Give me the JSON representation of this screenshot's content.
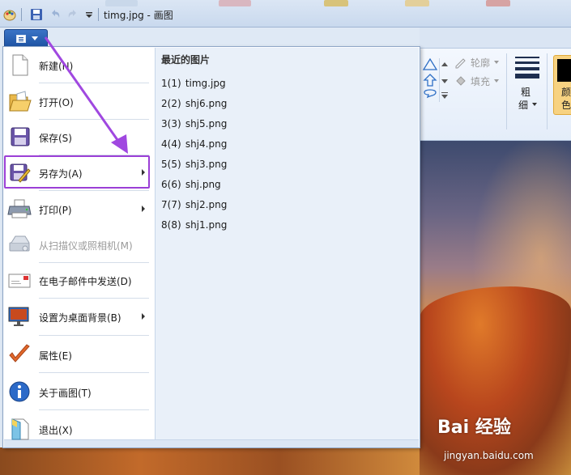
{
  "window": {
    "title": "timg.jpg - 画图"
  },
  "ribbon": {
    "outline_label": "轮廓",
    "fill_label": "填充",
    "size_label_1": "粗",
    "size_label_2": "细",
    "color_label_1": "颜",
    "color_label_2": "色"
  },
  "app_menu": {
    "items": [
      {
        "label": "新建(N)",
        "icon": "new-file-icon",
        "enabled": true,
        "submenu": false
      },
      {
        "label": "打开(O)",
        "icon": "open-folder-icon",
        "enabled": true,
        "submenu": false
      },
      {
        "label": "保存(S)",
        "icon": "save-disk-icon",
        "enabled": true,
        "submenu": false
      },
      {
        "label": "另存为(A)",
        "icon": "save-as-icon",
        "enabled": true,
        "submenu": true
      },
      {
        "label": "打印(P)",
        "icon": "printer-icon",
        "enabled": true,
        "submenu": true
      },
      {
        "label": "从扫描仪或照相机(M)",
        "icon": "scanner-icon",
        "enabled": false,
        "submenu": false
      },
      {
        "label": "在电子邮件中发送(D)",
        "icon": "email-icon",
        "enabled": true,
        "submenu": false
      },
      {
        "label": "设置为桌面背景(B)",
        "icon": "desktop-background-icon",
        "enabled": true,
        "submenu": true
      },
      {
        "label": "属性(E)",
        "icon": "checkmark-icon",
        "enabled": true,
        "submenu": false
      },
      {
        "label": "关于画图(T)",
        "icon": "info-icon",
        "enabled": true,
        "submenu": false
      },
      {
        "label": "退出(X)",
        "icon": "exit-icon",
        "enabled": true,
        "submenu": false
      }
    ],
    "recent_title": "最近的图片",
    "recent": [
      {
        "num": "1(1)",
        "name": "timg.jpg"
      },
      {
        "num": "2(2)",
        "name": "shj6.png"
      },
      {
        "num": "3(3)",
        "name": "shj5.png"
      },
      {
        "num": "4(4)",
        "name": "shj4.png"
      },
      {
        "num": "5(5)",
        "name": "shj3.png"
      },
      {
        "num": "6(6)",
        "name": "shj.png"
      },
      {
        "num": "7(7)",
        "name": "shj2.png"
      },
      {
        "num": "8(8)",
        "name": "shj1.png"
      }
    ]
  },
  "watermark": {
    "brand": "Bai 经验",
    "url": "jingyan.baidu.com"
  },
  "colors": {
    "menu_button": "#1f55a5",
    "highlight_box": "#9b3fd6",
    "annotation_arrow": "#a048e0"
  }
}
